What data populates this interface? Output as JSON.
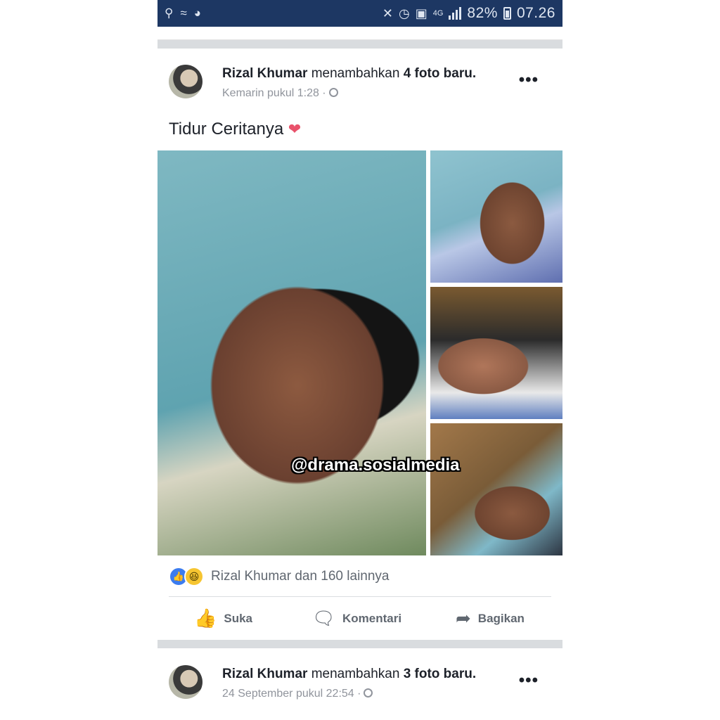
{
  "status_bar": {
    "left_icons": [
      "activity-icon",
      "swim-icon",
      "messenger-icon"
    ],
    "network": "4G",
    "battery_percent": "82%",
    "time": "07.26"
  },
  "posts": [
    {
      "author": "Rizal Khumar",
      "action_before": "menambahkan",
      "photo_count": "4 foto baru.",
      "timestamp": "Kemarin pukul 1:28 ·",
      "caption": "Tidur Ceritanya",
      "caption_emoji": "❤",
      "watermark": "@drama.sosialmedia",
      "reactions_text": "Rizal Khumar dan 160 lainnya",
      "actions": {
        "like": "Suka",
        "comment": "Komentari",
        "share": "Bagikan"
      }
    },
    {
      "author": "Rizal Khumar",
      "action_before": "menambahkan",
      "photo_count": "3 foto baru.",
      "timestamp": "24 September pukul 22:54 ·"
    }
  ],
  "colors": {
    "status_bar_bg": "#1d3763",
    "like_blue": "#3b7cef",
    "haha_yellow": "#f6c531",
    "heart_red": "#e9526b"
  }
}
